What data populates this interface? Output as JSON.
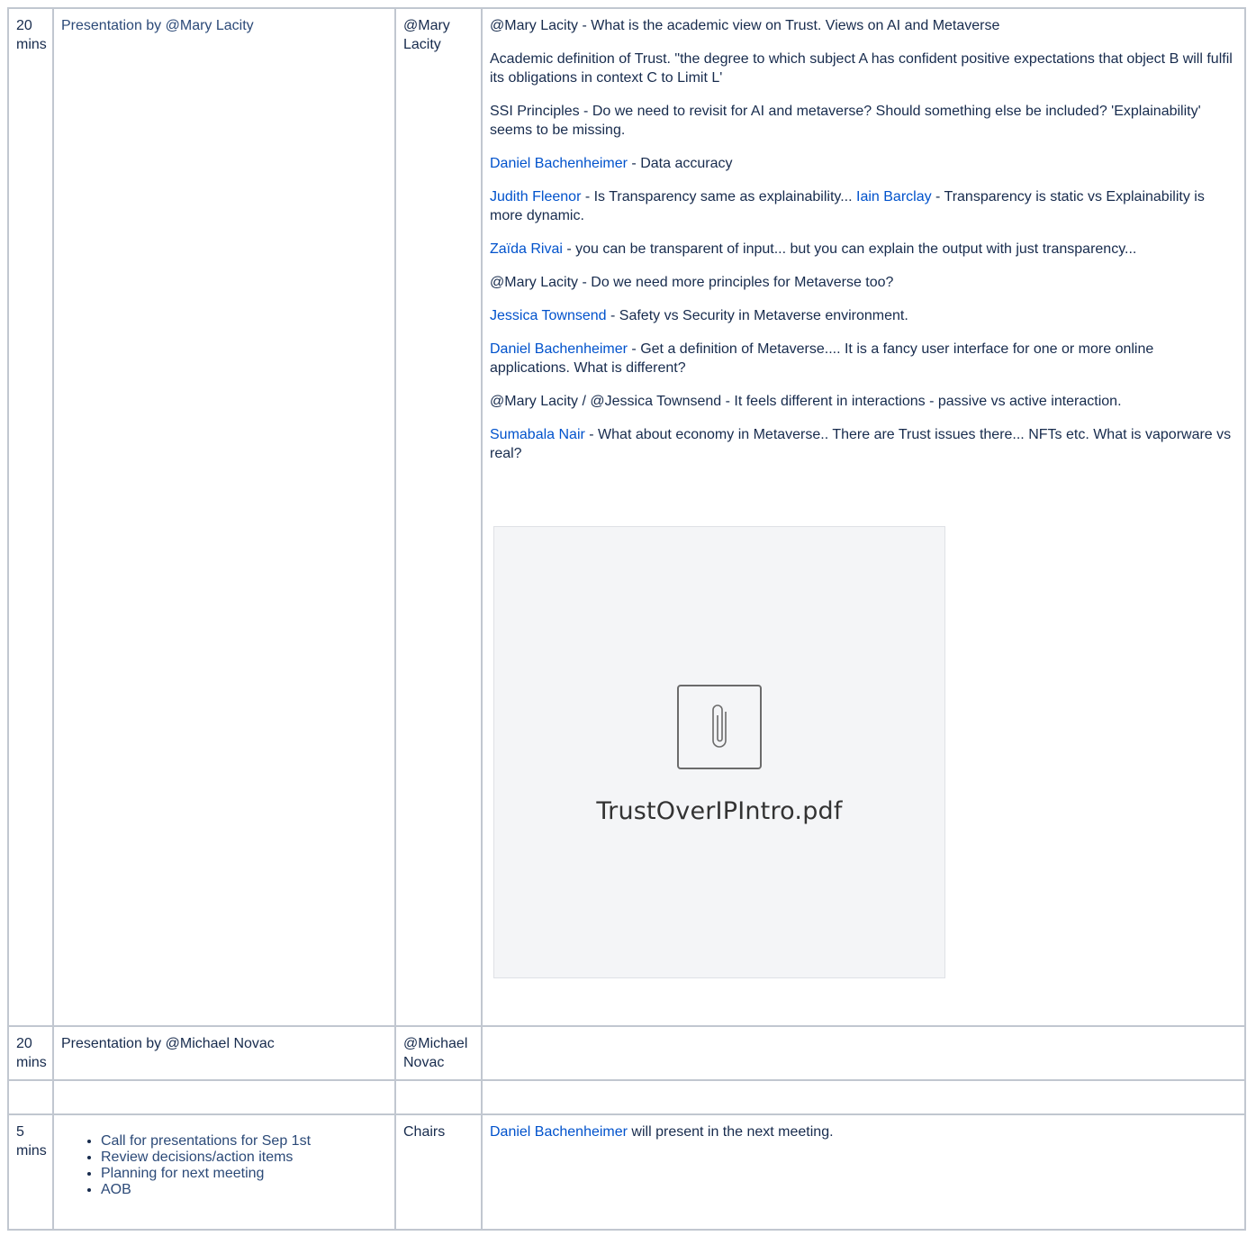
{
  "rows": [
    {
      "time": "20 mins",
      "item": "Presentation by @Mary Lacity",
      "who": "@Mary Lacity",
      "notes": [
        [
          {
            "t": "@Mary Lacity - What is the academic view on Trust. Views on AI and Metaverse"
          }
        ],
        [
          {
            "t": "Academic definition of Trust. \"the degree to which subject A has confident positive expectations that object B will fulfil its obligations in context C to Limit L'"
          }
        ],
        [
          {
            "t": "SSI Principles - Do we need to revisit for AI and metaverse? Should something else be included? 'Explainability' seems to be missing."
          }
        ],
        [
          {
            "t": "Daniel Bachenheimer",
            "link": true
          },
          {
            "t": " - Data accuracy"
          }
        ],
        [
          {
            "t": "Judith Fleenor",
            "link": true
          },
          {
            "t": " - Is Transparency same as explainability... "
          },
          {
            "t": "Iain Barclay",
            "link": true
          },
          {
            "t": " - Transparency is static vs Explainability is more dynamic."
          }
        ],
        [
          {
            "t": "Zaïda Rivai",
            "link": true
          },
          {
            "t": " - you can be transparent of input... but you can explain the output with just transparency..."
          }
        ],
        [
          {
            "t": "@Mary Lacity - Do we need more principles for Metaverse too?"
          }
        ],
        [
          {
            "t": "Jessica Townsend",
            "link": true
          },
          {
            "t": " - Safety vs Security in Metaverse environment."
          }
        ],
        [
          {
            "t": "Daniel Bachenheimer",
            "link": true
          },
          {
            "t": " - Get a definition of Metaverse.... It is a fancy user interface for one or more online applications. What is different?"
          }
        ],
        [
          {
            "t": "@Mary Lacity / @Jessica Townsend - It feels different in interactions - passive vs active interaction."
          }
        ],
        [
          {
            "t": "Sumabala Nair",
            "link": true
          },
          {
            "t": " - What about economy in Metaverse.. There are Trust issues there... NFTs etc. What is vaporware vs real?"
          }
        ]
      ],
      "attachment": {
        "filename": "TrustOverIPIntro.pdf",
        "icon": "paperclip-icon"
      }
    },
    {
      "time": "20 mins",
      "item": "Presentation by @Michael Novac",
      "who": "@Michael Novac",
      "notes": []
    },
    {
      "time": "",
      "item": "",
      "who": "",
      "notes": []
    },
    {
      "time": "5 mins",
      "items_list": [
        "Call for presentations for Sep 1st",
        "Review decisions/action items",
        "Planning for next meeting",
        "AOB"
      ],
      "who": "Chairs",
      "notes": [
        [
          {
            "t": "Daniel Bachenheimer",
            "link": true
          },
          {
            "t": " will present in the next meeting."
          }
        ]
      ]
    }
  ],
  "colors": {
    "link": "#0052cc",
    "border": "#c1c7d0",
    "text": "#172b4d"
  }
}
